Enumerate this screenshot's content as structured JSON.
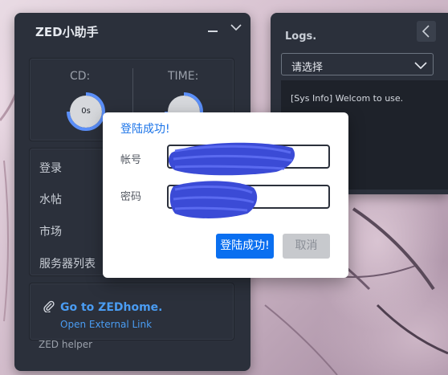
{
  "main_panel": {
    "title": "ZED小助手",
    "cd_label": "CD:",
    "time_label": "TIME:",
    "cd_value": "0s",
    "menu_items": [
      {
        "label": "登录"
      },
      {
        "label": "水帖"
      },
      {
        "label": "市场"
      },
      {
        "label": "服务器列表"
      }
    ],
    "link_title": "Go to ZEDhome.",
    "link_subtitle": "Open External Link",
    "footer": "ZED helper"
  },
  "logs_panel": {
    "title": "Logs.",
    "select_value": "请选择",
    "log_lines": [
      "[Sys Info] Welcom to use."
    ]
  },
  "modal": {
    "title": "登陆成功!",
    "account_label": "帐号",
    "password_label": "密码",
    "confirm_label": "登陆成功!",
    "cancel_label": "取消"
  },
  "colors": {
    "panel_bg": "#2b303b",
    "accent": "#0a6ff0",
    "link": "#4a9cf2",
    "gauge_ring": "#5b8ff9",
    "redaction": "#3b4bd6"
  },
  "icons": {
    "minimize": "minimize-icon",
    "collapse": "chevron-down-icon",
    "logs_back": "chevron-left-icon",
    "logs_select": "chevron-down-icon",
    "link": "paperclip-icon"
  }
}
